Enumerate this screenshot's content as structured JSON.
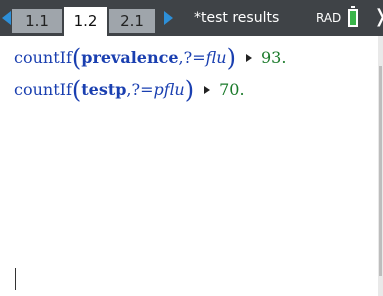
{
  "header": {
    "tabs": [
      {
        "label": "1.1"
      },
      {
        "label": "1.2"
      },
      {
        "label": "2.1"
      }
    ],
    "active_tab": "1.2",
    "document_title": "*test results",
    "angle_mode": "RAD",
    "icons": {
      "previous": "triangle-left-icon",
      "next": "triangle-right-icon",
      "battery": "battery-icon",
      "close": "close-icon"
    }
  },
  "calculator": {
    "entries": [
      {
        "function": "countIf",
        "open_paren": "(",
        "argument": "prevalence",
        "separator": ",",
        "condition_prefix": "?=",
        "condition_value": "flu",
        "close_paren": ")",
        "result": "93."
      },
      {
        "function": "countIf",
        "open_paren": "(",
        "argument": "testp",
        "separator": ",",
        "condition_prefix": "?=",
        "condition_value": "pflu",
        "close_paren": ")",
        "result": "70."
      }
    ]
  },
  "colors": {
    "tab_bar": "#3f4347",
    "nav_arrow": "#2d8fd8",
    "input_text": "#1a3fb0",
    "result_text": "#1a7a2a",
    "battery_fill": "#3ab54a"
  }
}
